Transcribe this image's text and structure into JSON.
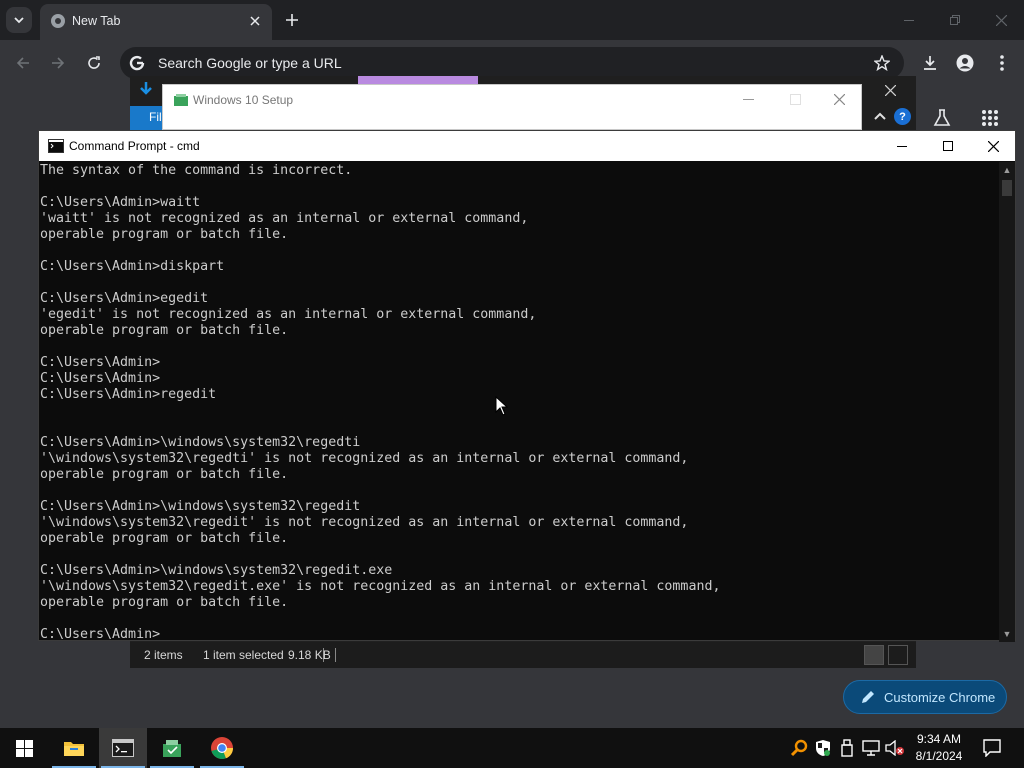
{
  "chrome": {
    "tab": {
      "title": "New Tab"
    },
    "omnibox": {
      "placeholder": "Search Google or type a URL"
    },
    "customize_label": "Customize Chrome"
  },
  "explorer": {
    "file_tab": "Fil",
    "status": {
      "items": "2 items",
      "selected": "1 item selected",
      "size": "9.18 KB"
    }
  },
  "setup": {
    "title": "Windows 10 Setup"
  },
  "cmd": {
    "title": "Command Prompt - cmd",
    "lines": [
      "The syntax of the command is incorrect.",
      "",
      "C:\\Users\\Admin>waitt",
      "'waitt' is not recognized as an internal or external command,",
      "operable program or batch file.",
      "",
      "C:\\Users\\Admin>diskpart",
      "",
      "C:\\Users\\Admin>egedit",
      "'egedit' is not recognized as an internal or external command,",
      "operable program or batch file.",
      "",
      "C:\\Users\\Admin>",
      "C:\\Users\\Admin>",
      "C:\\Users\\Admin>regedit",
      "",
      "",
      "C:\\Users\\Admin>\\windows\\system32\\regedti",
      "'\\windows\\system32\\regedti' is not recognized as an internal or external command,",
      "operable program or batch file.",
      "",
      "C:\\Users\\Admin>\\windows\\system32\\regedit",
      "'\\windows\\system32\\regedit' is not recognized as an internal or external command,",
      "operable program or batch file.",
      "",
      "C:\\Users\\Admin>\\windows\\system32\\regedit.exe",
      "'\\windows\\system32\\regedit.exe' is not recognized as an internal or external command,",
      "operable program or batch file.",
      "",
      "C:\\Users\\Admin>"
    ]
  },
  "taskbar": {
    "apps": [
      "start-icon",
      "file-explorer-icon",
      "command-prompt-icon",
      "windows-setup-icon",
      "chrome-icon"
    ],
    "clock": {
      "time": "9:34 AM",
      "date": "8/1/2024"
    }
  },
  "colors": {
    "chrome_bg": "#35363a",
    "console_bg": "#0c0c0c",
    "console_text": "#cccccc",
    "accent": "#0b4a79",
    "taskbar_bg": "#101010"
  }
}
